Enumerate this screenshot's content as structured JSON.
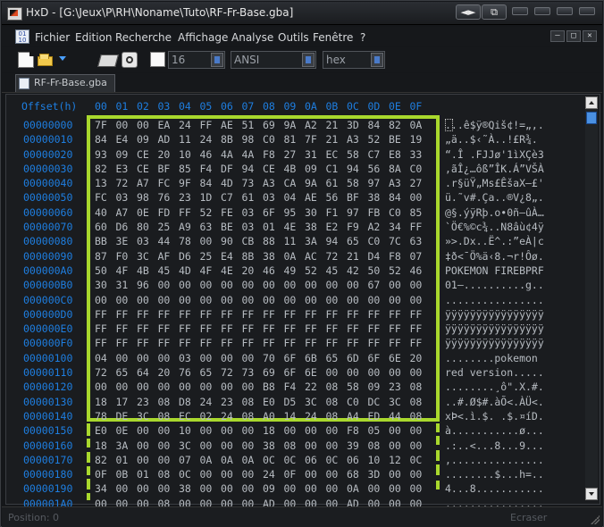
{
  "window": {
    "title": "HxD - [G:\\Jeux\\P\\RH\\Noname\\Tuto\\RF-Fr-Base.gba]",
    "nav_label": "◄►",
    "restore_label": "⧉"
  },
  "menu": [
    {
      "name": "menu-fichier",
      "label": "Fichier"
    },
    {
      "name": "menu-edition",
      "label": "Edition"
    },
    {
      "name": "menu-recherche",
      "label": "Recherche"
    },
    {
      "name": "menu-affichage",
      "label": "Affichage"
    },
    {
      "name": "menu-analyse",
      "label": "Analyse"
    },
    {
      "name": "menu-outils",
      "label": "Outils"
    },
    {
      "name": "menu-fenetre",
      "label": "Fenêtre"
    },
    {
      "name": "menu-help",
      "label": "?"
    }
  ],
  "menu_icon_text": "01 10",
  "mdi": {
    "minimize": "–",
    "restore": "□",
    "close": "✕"
  },
  "toolbar": {
    "bytes_per_row": "16",
    "charset": "ANSI",
    "display_mode": "hex"
  },
  "tab": {
    "label": "RF-Fr-Base.gba"
  },
  "editor": {
    "offset_label": "Offset(h)",
    "columns": [
      "00",
      "01",
      "02",
      "03",
      "04",
      "05",
      "06",
      "07",
      "08",
      "09",
      "0A",
      "0B",
      "0C",
      "0D",
      "0E",
      "0F"
    ],
    "rows": [
      {
        "offset": "00000000",
        "hex": [
          "7F",
          "00",
          "00",
          "EA",
          "24",
          "FF",
          "AE",
          "51",
          "69",
          "9A",
          "A2",
          "21",
          "3D",
          "84",
          "82",
          "0A"
        ],
        "text": "...ê$ÿ®Qiš¢!=„‚."
      },
      {
        "offset": "00000010",
        "hex": [
          "84",
          "E4",
          "09",
          "AD",
          "11",
          "24",
          "8B",
          "98",
          "C0",
          "81",
          "7F",
          "21",
          "A3",
          "52",
          "BE",
          "19"
        ],
        "text": "„ä..$‹˜À..!£R¾."
      },
      {
        "offset": "00000020",
        "hex": [
          "93",
          "09",
          "CE",
          "20",
          "10",
          "46",
          "4A",
          "4A",
          "F8",
          "27",
          "31",
          "EC",
          "58",
          "C7",
          "E8",
          "33"
        ],
        "text": "“.Î .FJJø'1ìXÇè3"
      },
      {
        "offset": "00000030",
        "hex": [
          "82",
          "E3",
          "CE",
          "BF",
          "85",
          "F4",
          "DF",
          "94",
          "CE",
          "4B",
          "09",
          "C1",
          "94",
          "56",
          "8A",
          "C0"
        ],
        "text": "‚ãÎ¿…ôß”ÎK.Á”VŠÀ"
      },
      {
        "offset": "00000040",
        "hex": [
          "13",
          "72",
          "A7",
          "FC",
          "9F",
          "84",
          "4D",
          "73",
          "A3",
          "CA",
          "9A",
          "61",
          "58",
          "97",
          "A3",
          "27"
        ],
        "text": ".r§üŸ„Ms£ÊšaX—£'"
      },
      {
        "offset": "00000050",
        "hex": [
          "FC",
          "03",
          "98",
          "76",
          "23",
          "1D",
          "C7",
          "61",
          "03",
          "04",
          "AE",
          "56",
          "BF",
          "38",
          "84",
          "00"
        ],
        "text": "ü.˜v#.Ça..®V¿8„."
      },
      {
        "offset": "00000060",
        "hex": [
          "40",
          "A7",
          "0E",
          "FD",
          "FF",
          "52",
          "FE",
          "03",
          "6F",
          "95",
          "30",
          "F1",
          "97",
          "FB",
          "C0",
          "85"
        ],
        "text": "@§.ýÿRþ.o•0ñ—ûÀ…"
      },
      {
        "offset": "00000070",
        "hex": [
          "60",
          "D6",
          "80",
          "25",
          "A9",
          "63",
          "BE",
          "03",
          "01",
          "4E",
          "38",
          "E2",
          "F9",
          "A2",
          "34",
          "FF"
        ],
        "text": "`Ö€%©c¾..N8âù¢4ÿ"
      },
      {
        "offset": "00000080",
        "hex": [
          "BB",
          "3E",
          "03",
          "44",
          "78",
          "00",
          "90",
          "CB",
          "88",
          "11",
          "3A",
          "94",
          "65",
          "C0",
          "7C",
          "63"
        ],
        "text": "»>.Dx..Ë^.:”eÀ|c"
      },
      {
        "offset": "00000090",
        "hex": [
          "87",
          "F0",
          "3C",
          "AF",
          "D6",
          "25",
          "E4",
          "8B",
          "38",
          "0A",
          "AC",
          "72",
          "21",
          "D4",
          "F8",
          "07"
        ],
        "text": "‡ð<¯Ö%ä‹8.¬r!Ôø."
      },
      {
        "offset": "000000A0",
        "hex": [
          "50",
          "4F",
          "4B",
          "45",
          "4D",
          "4F",
          "4E",
          "20",
          "46",
          "49",
          "52",
          "45",
          "42",
          "50",
          "52",
          "46"
        ],
        "text": "POKEMON FIREBPRF"
      },
      {
        "offset": "000000B0",
        "hex": [
          "30",
          "31",
          "96",
          "00",
          "00",
          "00",
          "00",
          "00",
          "00",
          "00",
          "00",
          "00",
          "00",
          "67",
          "00",
          "00"
        ],
        "text": "01–..........g.."
      },
      {
        "offset": "000000C0",
        "hex": [
          "00",
          "00",
          "00",
          "00",
          "00",
          "00",
          "00",
          "00",
          "00",
          "00",
          "00",
          "00",
          "00",
          "00",
          "00",
          "00"
        ],
        "text": "................"
      },
      {
        "offset": "000000D0",
        "hex": [
          "FF",
          "FF",
          "FF",
          "FF",
          "FF",
          "FF",
          "FF",
          "FF",
          "FF",
          "FF",
          "FF",
          "FF",
          "FF",
          "FF",
          "FF",
          "FF"
        ],
        "text": "ÿÿÿÿÿÿÿÿÿÿÿÿÿÿÿÿ"
      },
      {
        "offset": "000000E0",
        "hex": [
          "FF",
          "FF",
          "FF",
          "FF",
          "FF",
          "FF",
          "FF",
          "FF",
          "FF",
          "FF",
          "FF",
          "FF",
          "FF",
          "FF",
          "FF",
          "FF"
        ],
        "text": "ÿÿÿÿÿÿÿÿÿÿÿÿÿÿÿÿ"
      },
      {
        "offset": "000000F0",
        "hex": [
          "FF",
          "FF",
          "FF",
          "FF",
          "FF",
          "FF",
          "FF",
          "FF",
          "FF",
          "FF",
          "FF",
          "FF",
          "FF",
          "FF",
          "FF",
          "FF"
        ],
        "text": "ÿÿÿÿÿÿÿÿÿÿÿÿÿÿÿÿ"
      },
      {
        "offset": "00000100",
        "hex": [
          "04",
          "00",
          "00",
          "00",
          "03",
          "00",
          "00",
          "00",
          "70",
          "6F",
          "6B",
          "65",
          "6D",
          "6F",
          "6E",
          "20"
        ],
        "text": "........pokemon "
      },
      {
        "offset": "00000110",
        "hex": [
          "72",
          "65",
          "64",
          "20",
          "76",
          "65",
          "72",
          "73",
          "69",
          "6F",
          "6E",
          "00",
          "00",
          "00",
          "00",
          "00"
        ],
        "text": "red version....."
      },
      {
        "offset": "00000120",
        "hex": [
          "00",
          "00",
          "00",
          "00",
          "00",
          "00",
          "00",
          "00",
          "B8",
          "F4",
          "22",
          "08",
          "58",
          "09",
          "23",
          "08"
        ],
        "text": "........¸ô\".X.#."
      },
      {
        "offset": "00000130",
        "hex": [
          "18",
          "17",
          "23",
          "08",
          "D8",
          "24",
          "23",
          "08",
          "E0",
          "D5",
          "3C",
          "08",
          "C0",
          "DC",
          "3C",
          "08"
        ],
        "text": "..#.Ø$#.àÕ<.ÀÜ<."
      },
      {
        "offset": "00000140",
        "hex": [
          "78",
          "DE",
          "3C",
          "08",
          "EC",
          "02",
          "24",
          "08",
          "A0",
          "14",
          "24",
          "08",
          "A4",
          "ED",
          "44",
          "08"
        ],
        "text": "xÞ<.ì.$. .$.¤íD."
      },
      {
        "offset": "00000150",
        "hex": [
          "E0",
          "0E",
          "00",
          "00",
          "10",
          "00",
          "00",
          "00",
          "18",
          "00",
          "00",
          "00",
          "F8",
          "05",
          "00",
          "00"
        ],
        "text": "à...........ø..."
      },
      {
        "offset": "00000160",
        "hex": [
          "18",
          "3A",
          "00",
          "00",
          "3C",
          "00",
          "00",
          "00",
          "38",
          "08",
          "00",
          "00",
          "39",
          "08",
          "00",
          "00"
        ],
        "text": ".:..<...8...9..."
      },
      {
        "offset": "00000170",
        "hex": [
          "82",
          "01",
          "00",
          "00",
          "07",
          "0A",
          "0A",
          "0A",
          "0C",
          "0C",
          "06",
          "0C",
          "06",
          "10",
          "12",
          "0C"
        ],
        "text": "‚..............."
      },
      {
        "offset": "00000180",
        "hex": [
          "0F",
          "0B",
          "01",
          "08",
          "0C",
          "00",
          "00",
          "00",
          "24",
          "0F",
          "00",
          "00",
          "68",
          "3D",
          "00",
          "00"
        ],
        "text": "........$...h=.."
      },
      {
        "offset": "00000190",
        "hex": [
          "34",
          "00",
          "00",
          "00",
          "38",
          "00",
          "00",
          "00",
          "09",
          "00",
          "00",
          "00",
          "0A",
          "00",
          "00",
          "00"
        ],
        "text": "4...8..........."
      },
      {
        "offset": "000001A0",
        "hex": [
          "00",
          "00",
          "00",
          "08",
          "00",
          "00",
          "00",
          "00",
          "AD",
          "00",
          "00",
          "00",
          "AD",
          "00",
          "00",
          "00"
        ],
        "text": "................"
      }
    ]
  },
  "status": {
    "position": "Position: 0",
    "mode": "Ecraser"
  },
  "colors": {
    "selection": "#a9d82d",
    "offset_text": "#1e7ee0",
    "hex_text": "#b7bcc2"
  }
}
